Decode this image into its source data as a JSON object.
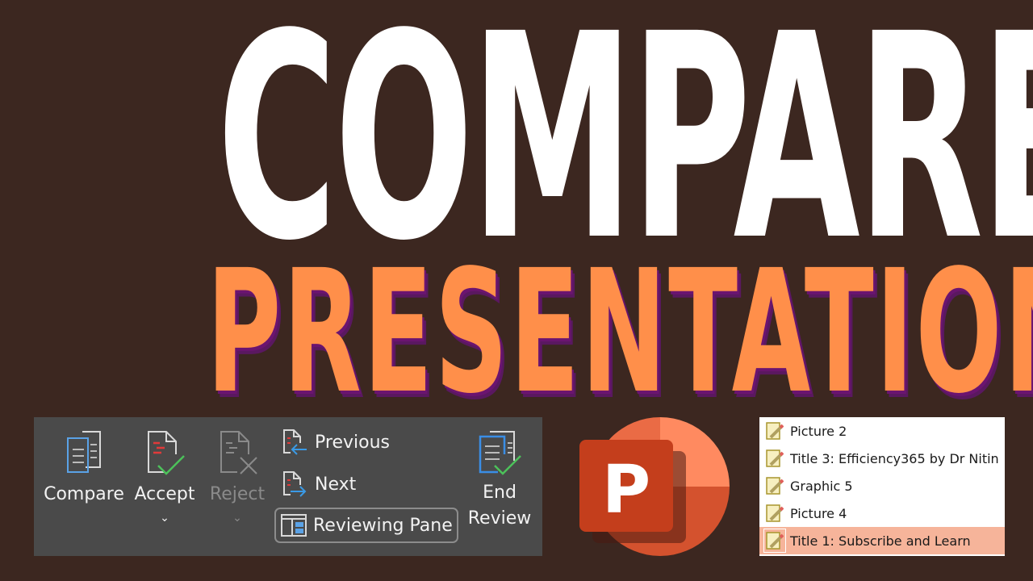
{
  "headline": {
    "line1": "COMPARE",
    "line2": "PRESENTATIONS"
  },
  "colors": {
    "background": "#3c2720",
    "line1": "#ffffff",
    "line2": "#ff8f4a",
    "line2_shadow": "#6b1470",
    "ribbon_bg": "#4a4a4a",
    "selected_row": "#f6b49a",
    "accept_check": "#4cc15a",
    "doc_blue": "#4a90d9",
    "change_red": "#e03a3a"
  },
  "ribbon": {
    "compare": {
      "label": "Compare",
      "icon": "compare-documents-icon"
    },
    "accept": {
      "label": "Accept",
      "icon": "accept-change-icon",
      "dropdown": "⌄"
    },
    "reject": {
      "label": "Reject",
      "icon": "reject-change-icon",
      "dropdown": "⌄",
      "disabled": true
    },
    "previous": {
      "label": "Previous",
      "icon": "previous-change-icon"
    },
    "next": {
      "label": "Next",
      "icon": "next-change-icon"
    },
    "reviewing_pane": {
      "label": "Reviewing Pane",
      "icon": "reviewing-pane-icon"
    },
    "end_review": {
      "label_line1": "End",
      "label_line2": "Review",
      "icon": "end-review-icon"
    }
  },
  "logo": {
    "letter": "P",
    "name": "powerpoint-logo"
  },
  "reviewing_list": {
    "items": [
      {
        "label": "Picture 2",
        "selected": false
      },
      {
        "label": "Title 3: Efficiency365 by Dr Nitin",
        "selected": false
      },
      {
        "label": "Graphic 5",
        "selected": false
      },
      {
        "label": "Picture 4",
        "selected": false
      },
      {
        "label": "Title 1: Subscribe and Learn",
        "selected": true
      }
    ]
  }
}
